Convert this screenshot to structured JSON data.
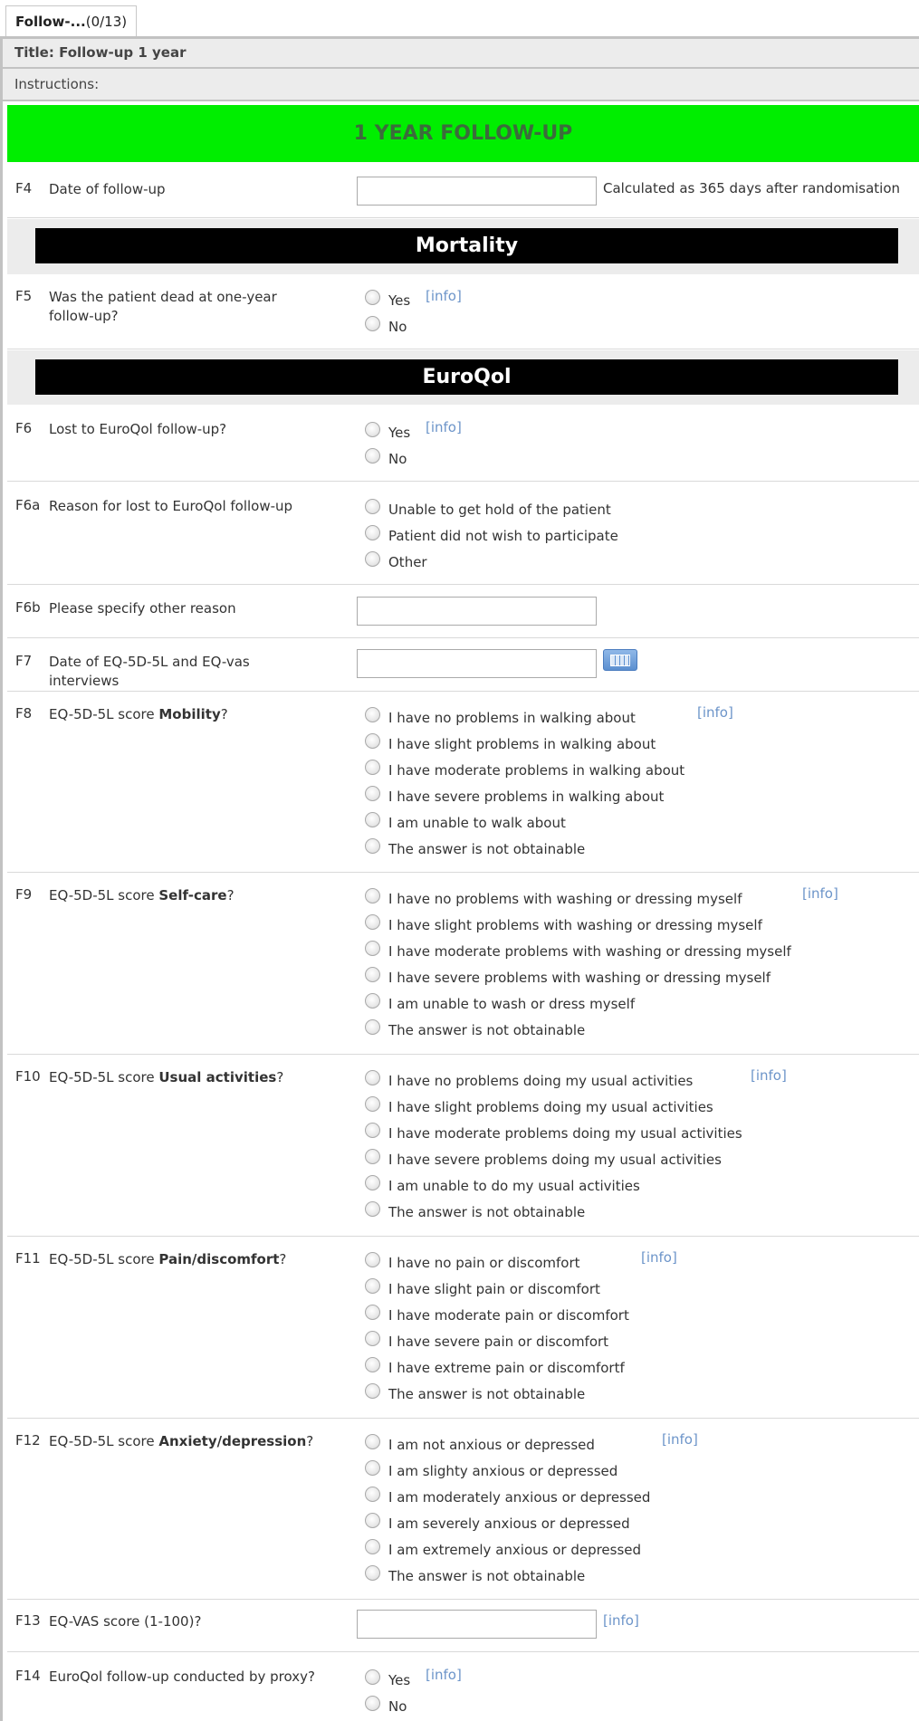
{
  "tab": {
    "name": "Follow-...",
    "count": "(0/13)"
  },
  "title": "Title: Follow-up 1 year",
  "instructions": "Instructions:",
  "section_main": "1 YEAR FOLLOW-UP",
  "section_mortality": "Mortality",
  "section_euroqol": "EuroQol",
  "info_label": "[info]",
  "questions": {
    "f4": {
      "num": "F4",
      "text": "Date of follow-up",
      "note": "Calculated as 365 days after randomisation",
      "value": ""
    },
    "f5": {
      "num": "F5",
      "text": "Was the patient dead at one-year follow-up?",
      "options": [
        "Yes",
        "No"
      ]
    },
    "f6": {
      "num": "F6",
      "text": "Lost to EuroQol follow-up?",
      "options": [
        "Yes",
        "No"
      ]
    },
    "f6a": {
      "num": "F6a",
      "text": "Reason for lost to EuroQol follow-up",
      "options": [
        "Unable to get hold of the patient",
        "Patient did not wish to participate",
        "Other"
      ]
    },
    "f6b": {
      "num": "F6b",
      "text": "Please specify other reason",
      "value": ""
    },
    "f7": {
      "num": "F7",
      "text": "Date of EQ-5D-5L and EQ-vas interviews",
      "value": ""
    },
    "f8": {
      "num": "F8",
      "prefix": "EQ-5D-5L score ",
      "bold": "Mobility",
      "suffix": "?",
      "options": [
        "I have no problems in walking about",
        "I have slight problems in walking about",
        "I have moderate problems in walking about",
        "I have severe problems in walking about",
        "I am unable to walk about",
        "The answer is not obtainable"
      ]
    },
    "f9": {
      "num": "F9",
      "prefix": "EQ-5D-5L score ",
      "bold": "Self-care",
      "suffix": "?",
      "options": [
        "I have no problems with washing or dressing myself",
        "I have slight problems with washing or dressing myself",
        "I have moderate problems with washing or dressing myself",
        "I have severe problems with washing or dressing myself",
        "I am unable to wash or dress myself",
        "The answer is not obtainable"
      ]
    },
    "f10": {
      "num": "F10",
      "prefix": "EQ-5D-5L score ",
      "bold": "Usual activities",
      "suffix": "?",
      "options": [
        "I have no problems doing my usual activities",
        "I have slight problems doing my usual activities",
        "I have moderate problems doing my usual activities",
        "I have severe problems doing my usual activities",
        "I am unable to do my usual activities",
        "The answer is not obtainable"
      ]
    },
    "f11": {
      "num": "F11",
      "prefix": "EQ-5D-5L score ",
      "bold": "Pain/discomfort",
      "suffix": "?",
      "options": [
        "I have no pain or discomfort",
        "I have slight pain or discomfort",
        "I have moderate pain or discomfort",
        "I have severe pain or discomfort",
        "I have extreme pain or discomfortf",
        "The answer is not obtainable"
      ]
    },
    "f12": {
      "num": "F12",
      "prefix": "EQ-5D-5L score ",
      "bold": "Anxiety/depression",
      "suffix": "?",
      "options": [
        "I am not anxious or depressed",
        "I am slighty anxious or depressed",
        "I am moderately anxious or depressed",
        "I am severely anxious or depressed",
        "I am extremely anxious or depressed",
        "The answer is not obtainable"
      ]
    },
    "f13": {
      "num": "F13",
      "text": "EQ-VAS score (1-100)?",
      "value": ""
    },
    "f14": {
      "num": "F14",
      "text": "EuroQol follow-up conducted by proxy?",
      "options": [
        "Yes",
        "No"
      ]
    }
  }
}
